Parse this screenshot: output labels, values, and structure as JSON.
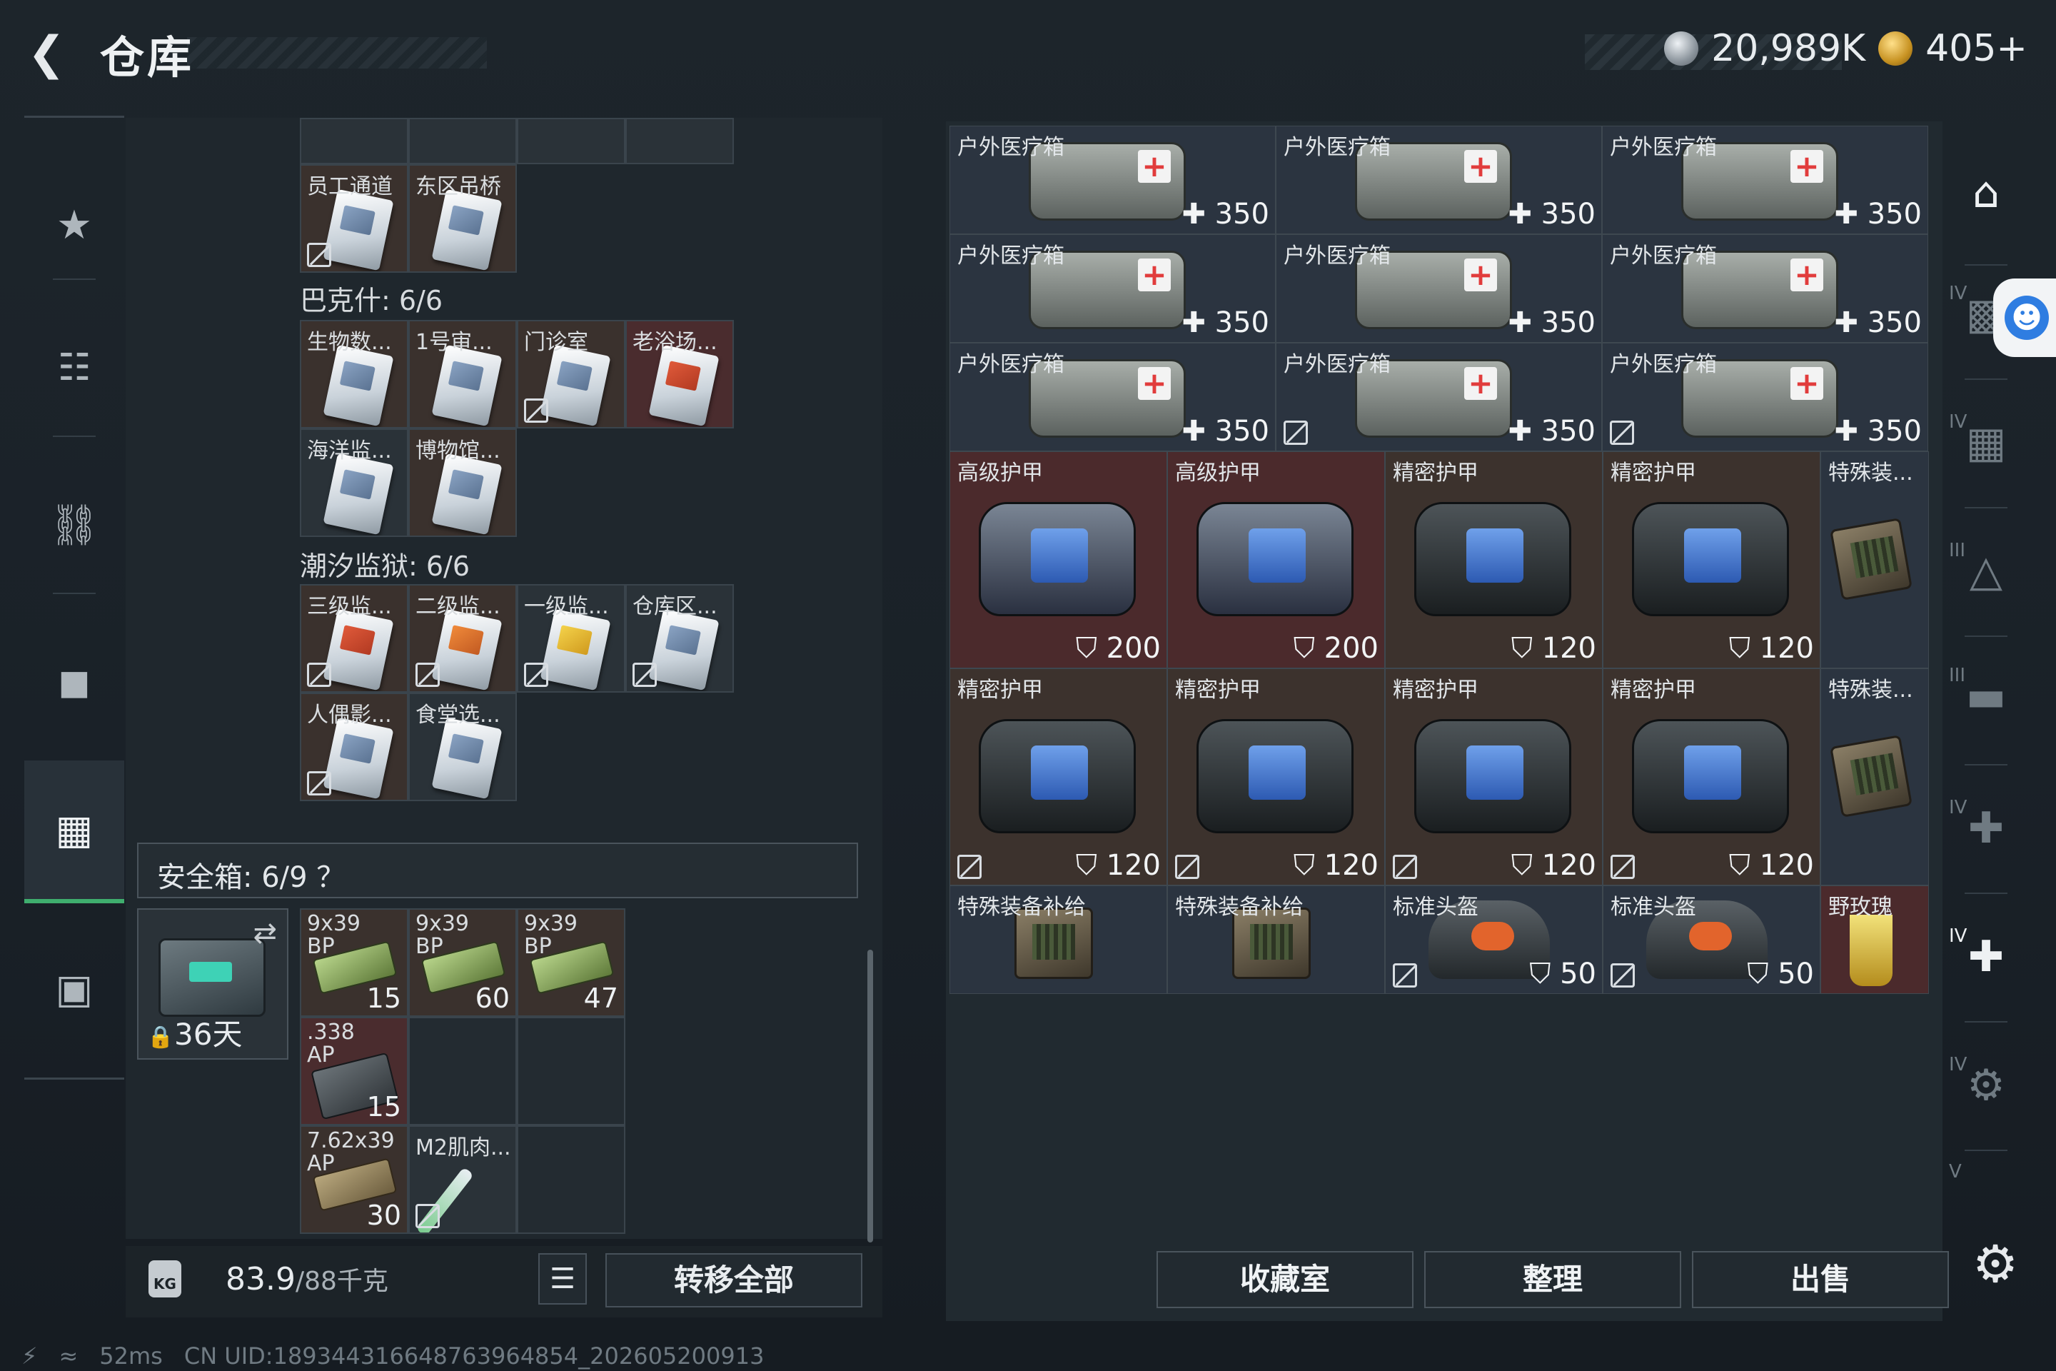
{
  "header": {
    "title": "仓库",
    "currency_silver": "20,989K",
    "currency_gold": "405+"
  },
  "left_nav": [
    "gun-icon",
    "vest-icon",
    "backpack-icon",
    "bag-icon",
    "safe-case-icon",
    "briefcase-icon"
  ],
  "keycards_top": {
    "rows": [
      {
        "items": [
          {
            "label": "员工通道",
            "noicon": true
          },
          {
            "label": "东区吊桥",
            "noicon": false
          }
        ]
      }
    ]
  },
  "bakeshi": {
    "title": "巴克什: 6/6",
    "items": [
      {
        "label": "生物数...",
        "style": "brown"
      },
      {
        "label": "1号审...",
        "style": "brown"
      },
      {
        "label": "门诊室",
        "style": "brown",
        "noicon": true
      },
      {
        "label": "老浴场...",
        "style": "red",
        "card": "redcard"
      },
      {
        "label": "海洋监...",
        "style": "empty-blue"
      },
      {
        "label": "博物馆...",
        "style": "brown"
      }
    ]
  },
  "prison": {
    "title": "潮汐监狱: 6/6",
    "items": [
      {
        "label": "三级监...",
        "style": "brown",
        "card": "redcard",
        "noicon": true
      },
      {
        "label": "二级监...",
        "style": "brown",
        "card": "orange",
        "noicon": true
      },
      {
        "label": "一级监...",
        "style": "blue",
        "card": "yellow",
        "noicon": true
      },
      {
        "label": "仓库区...",
        "style": "blue",
        "noicon": true
      },
      {
        "label": "人偶影...",
        "style": "brown",
        "noicon": true
      },
      {
        "label": "食堂选...",
        "style": "blue"
      }
    ]
  },
  "safebox": {
    "label": "安全箱:  6/9  ？",
    "days": "36天",
    "items": [
      {
        "label": "9x39\nBP",
        "count": "15"
      },
      {
        "label": "9x39\nBP",
        "count": "60"
      },
      {
        "label": "9x39\nBP",
        "count": "47"
      },
      {
        "label": ".338\nAP",
        "count": "15"
      },
      {
        "label": "7.62x39\nAP",
        "count": "30"
      },
      {
        "label": "M2肌肉...",
        "count": ""
      }
    ]
  },
  "footer_left": {
    "weight": "83.9",
    "weight_max": "/88千克",
    "transfer_label": "转移全部"
  },
  "status": {
    "ping": "52ms",
    "uid": "CN UID:189344316648763964854_202605200913"
  },
  "stash": {
    "medkits": {
      "label": "户外医疗箱",
      "value": "350"
    },
    "row_armor1": [
      {
        "label": "高级护甲",
        "value": "200",
        "style": "red"
      },
      {
        "label": "高级护甲",
        "value": "200",
        "style": "red"
      },
      {
        "label": "精密护甲",
        "value": "120",
        "style": "brown"
      },
      {
        "label": "精密护甲",
        "value": "120",
        "style": "brown"
      },
      {
        "label": "特殊装...",
        "value": "",
        "style": "blue"
      }
    ],
    "row_armor2": [
      {
        "label": "精密护甲",
        "value": "120",
        "style": "brown"
      },
      {
        "label": "精密护甲",
        "value": "120",
        "style": "brown"
      },
      {
        "label": "精密护甲",
        "value": "120",
        "style": "brown"
      },
      {
        "label": "精密护甲",
        "value": "120",
        "style": "brown"
      },
      {
        "label": "特殊装...",
        "value": "",
        "style": "blue"
      }
    ],
    "row_last": [
      {
        "label": "特殊装备补给",
        "value": ""
      },
      {
        "label": "特殊装备补给",
        "value": ""
      },
      {
        "label": "标准头盔",
        "value": "50"
      },
      {
        "label": "标准头盔",
        "value": "50"
      },
      {
        "label": "野玫瑰",
        "value": ""
      }
    ]
  },
  "footer_right": {
    "collection": "收藏室",
    "sort": "整理",
    "sell": "出售"
  },
  "right_nav_tags": [
    "IV",
    "IV",
    "III",
    "III",
    "IV",
    "IV",
    "IV",
    "V"
  ]
}
